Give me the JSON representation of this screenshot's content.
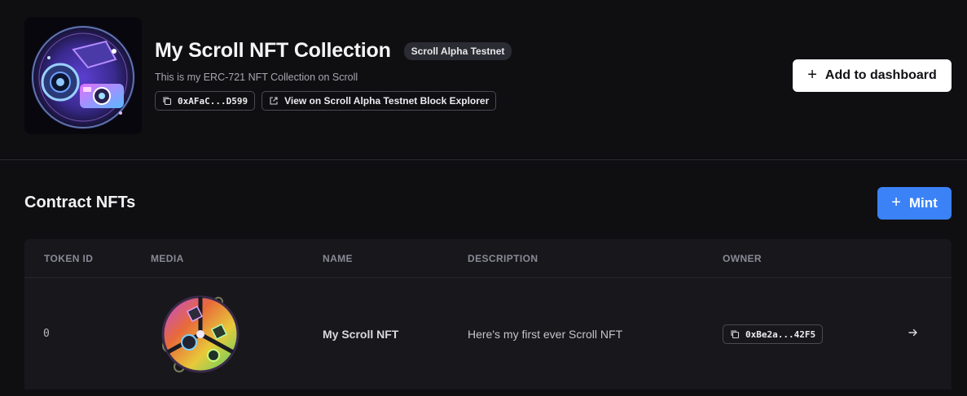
{
  "collection": {
    "title": "My Scroll NFT Collection",
    "chain_badge": "Scroll Alpha Testnet",
    "description": "This is my ERC-721 NFT Collection on Scroll",
    "address_short": "0xAFaC...D599",
    "explorer_link": "View on Scroll Alpha Testnet Block Explorer",
    "add_dashboard_label": "Add to dashboard"
  },
  "section": {
    "title": "Contract NFTs",
    "mint_label": "Mint"
  },
  "table": {
    "columns": [
      "TOKEN ID",
      "MEDIA",
      "NAME",
      "DESCRIPTION",
      "OWNER"
    ],
    "rows": [
      {
        "token_id": "0",
        "name": "My Scroll NFT",
        "description": "Here's my first ever Scroll NFT",
        "owner_short": "0xBe2a...42F5"
      }
    ]
  },
  "icons": {
    "copy": "copy-icon",
    "external": "external-link-icon",
    "plus": "plus-icon",
    "arrow": "arrow-right-icon"
  },
  "colors": {
    "background": "#0f0f12",
    "table_bg": "#17171c",
    "accent": "#3b82f6",
    "badge_bg": "#2b2b33"
  }
}
